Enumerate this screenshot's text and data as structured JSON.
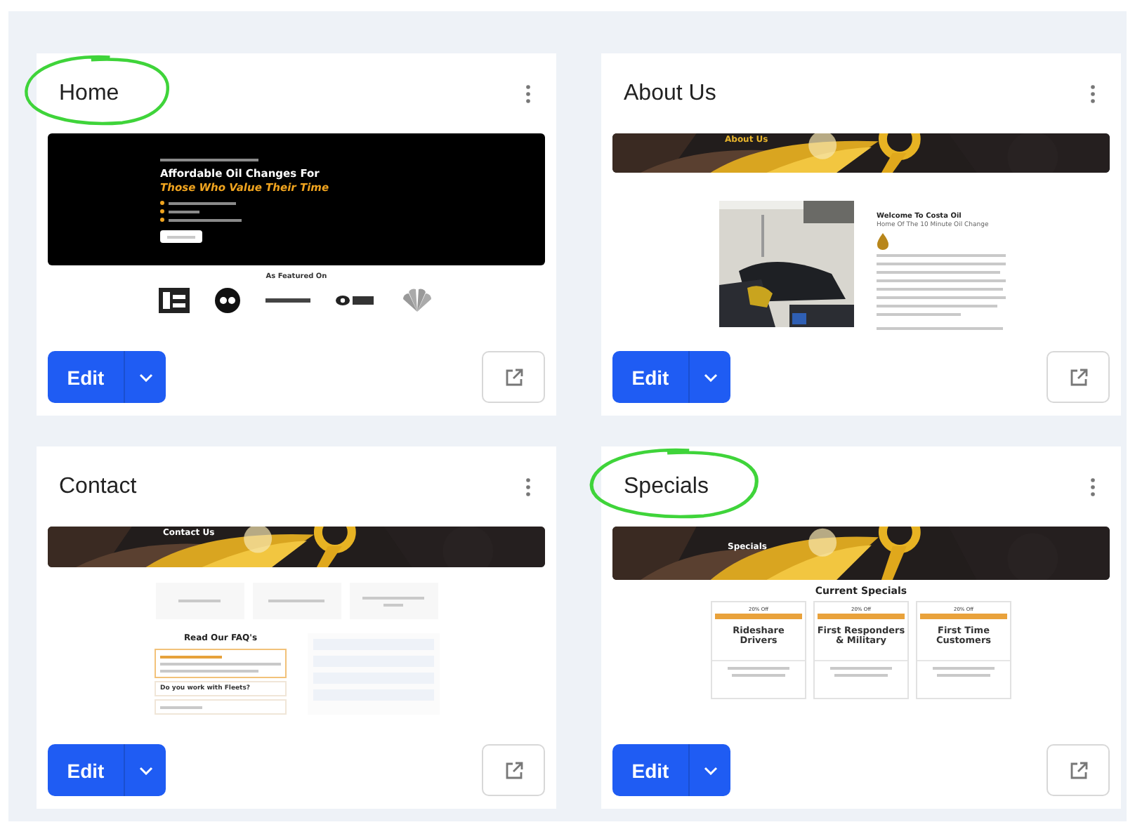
{
  "cards": [
    {
      "title": "Home",
      "circled": true,
      "edit_label": "Edit",
      "thumbnail": {
        "kind": "home",
        "hero_title": "Affordable Oil Changes For",
        "hero_tagline": "Those Who Value Their Time",
        "featured_heading": "As Featured On"
      }
    },
    {
      "title": "About Us",
      "circled": false,
      "edit_label": "Edit",
      "thumbnail": {
        "kind": "about",
        "banner_title": "About Us",
        "heading": "Welcome To Costa Oil",
        "subheading": "Home Of The 10 Minute Oil Change"
      }
    },
    {
      "title": "Contact",
      "circled": false,
      "edit_label": "Edit",
      "thumbnail": {
        "kind": "contact",
        "banner_title": "Contact Us",
        "faq_heading": "Read Our FAQ's",
        "faq_question": "Do you work with Fleets?"
      }
    },
    {
      "title": "Specials",
      "circled": true,
      "edit_label": "Edit",
      "thumbnail": {
        "kind": "specials",
        "banner_title": "Specials",
        "heading": "Current Specials",
        "offers": [
          {
            "badge": "20% Off",
            "title": "Rideshare Drivers"
          },
          {
            "badge": "20% Off",
            "title": "First Responders & Military"
          },
          {
            "badge": "20% Off",
            "title": "First Time Customers"
          }
        ]
      }
    }
  ]
}
